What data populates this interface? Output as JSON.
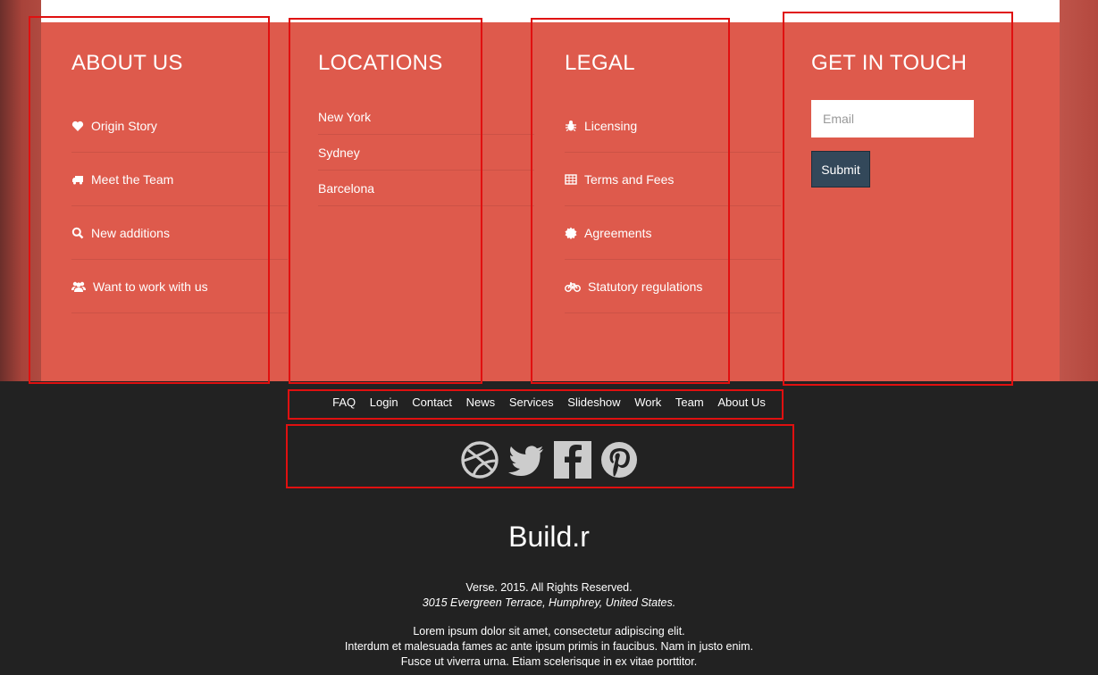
{
  "about": {
    "title": "ABOUT US",
    "items": [
      {
        "label": "Origin Story",
        "icon": "heart-icon"
      },
      {
        "label": "Meet the Team",
        "icon": "truck-icon"
      },
      {
        "label": "New additions",
        "icon": "search-icon"
      },
      {
        "label": "Want to work with us",
        "icon": "users-icon"
      }
    ]
  },
  "locations": {
    "title": "LOCATIONS",
    "items": [
      {
        "label": "New York"
      },
      {
        "label": "Sydney"
      },
      {
        "label": "Barcelona"
      }
    ]
  },
  "legal": {
    "title": "LEGAL",
    "items": [
      {
        "label": "Licensing",
        "icon": "bug-icon"
      },
      {
        "label": "Terms and Fees",
        "icon": "table-icon"
      },
      {
        "label": "Agreements",
        "icon": "certificate-icon"
      },
      {
        "label": "Statutory regulations",
        "icon": "bicycle-icon"
      }
    ]
  },
  "contact": {
    "title": "GET IN TOUCH",
    "email_placeholder": "Email",
    "submit_label": "Submit"
  },
  "footer_nav": [
    "FAQ",
    "Login",
    "Contact",
    "News",
    "Services",
    "Slideshow",
    "Work",
    "Team",
    "About Us"
  ],
  "social": [
    "dribbble-icon",
    "twitter-icon",
    "facebook-icon",
    "pinterest-icon"
  ],
  "brand": "Build.r",
  "copyright": "Verse. 2015. All Rights Reserved.",
  "address": "3015 Evergreen Terrace, Humphrey, United States.",
  "lorem": [
    "Lorem ipsum dolor sit amet, consectetur adipiscing elit.",
    "Interdum et malesuada fames ac ante ipsum primis in faucibus. Nam in justo enim.",
    "Fusce ut viverra urna. Etiam scelerisque in ex vitae porttitor."
  ],
  "colors": {
    "panel": "#de5a4c",
    "footer": "#222222",
    "button": "#33485a",
    "highlight": "#e01010"
  }
}
